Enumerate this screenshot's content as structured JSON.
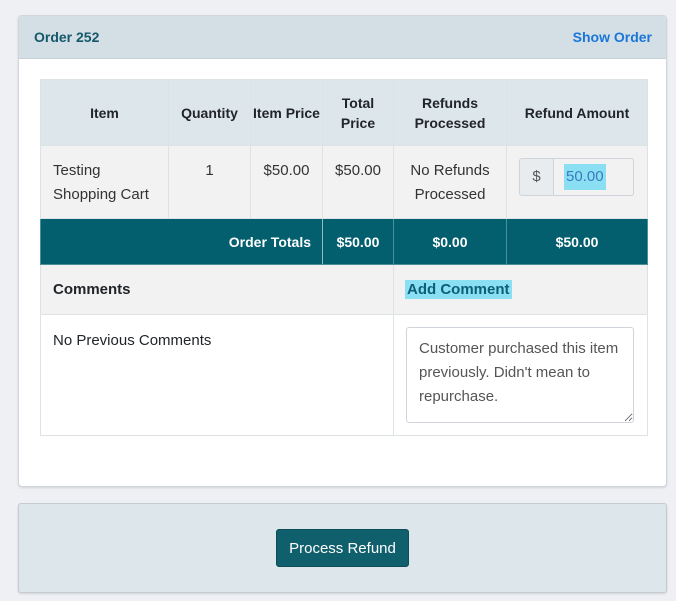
{
  "card": {
    "title": "Order 252",
    "show_order_label": "Show Order"
  },
  "table": {
    "headers": [
      "Item",
      "Quantity",
      "Item Price",
      "Total Price",
      "Refunds Processed",
      "Refund Amount"
    ],
    "item": {
      "name": "Testing Shopping Cart",
      "quantity": "1",
      "item_price": "$50.00",
      "total_price": "$50.00",
      "refunds_processed": "No Refunds Processed",
      "refund_currency": "$",
      "refund_amount": "50.00"
    },
    "totals": {
      "label": "Order Totals",
      "total_price": "$50.00",
      "refunds_processed": "$0.00",
      "refund_amount": "$50.00"
    },
    "comments": {
      "title": "Comments",
      "add_label": "Add Comment",
      "previous": "No Previous Comments",
      "draft": "Customer purchased this item previously. Didn't mean to repurchase."
    }
  },
  "footer": {
    "process_label": "Process Refund"
  },
  "colors": {
    "header_bg": "#d3dfe5",
    "totals_bg": "#035f6e",
    "button_bg": "#105f6c",
    "link": "#1b76d9",
    "highlight": "#8ae0f2"
  }
}
